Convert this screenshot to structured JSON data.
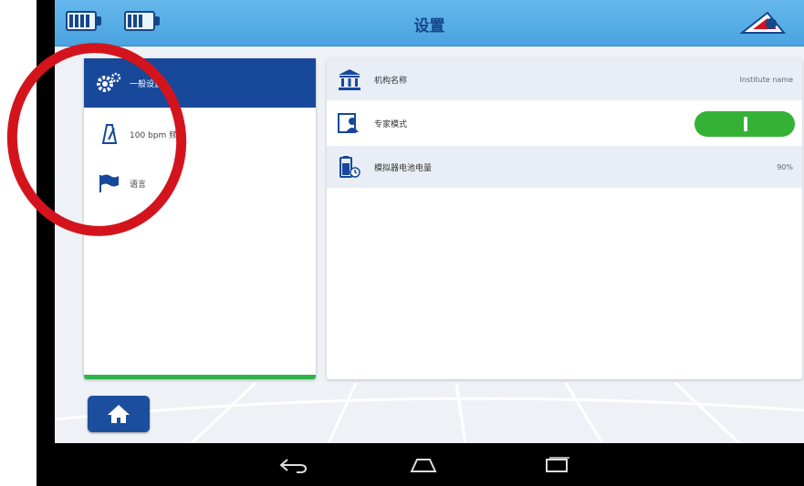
{
  "header": {
    "title": "设置",
    "battery1_cells": 4,
    "battery2_cells": 3
  },
  "sidebar": {
    "items": [
      {
        "label": "一般设置",
        "icon": "gear-icon",
        "active": true
      },
      {
        "label": "100 bpm 频",
        "icon": "metronome-icon",
        "active": false
      },
      {
        "label": "语言",
        "icon": "flag-icon",
        "active": false
      }
    ],
    "progress": 1.0
  },
  "settings": {
    "rows": [
      {
        "label": "机构名称",
        "value": "Institute name",
        "icon": "institution-icon"
      },
      {
        "label": "专家模式",
        "toggle": true,
        "icon": "expert-user-icon"
      },
      {
        "label": "模拟器电池电量",
        "value": "90%",
        "icon": "battery-level-icon"
      }
    ]
  },
  "colors": {
    "header_bg": "#4aa3e0",
    "active_item": "#17489a",
    "toggle_on": "#35b136",
    "annotation": "#d4141c"
  },
  "nav": [
    "back-icon",
    "home-nav-icon",
    "recent-apps-icon"
  ]
}
